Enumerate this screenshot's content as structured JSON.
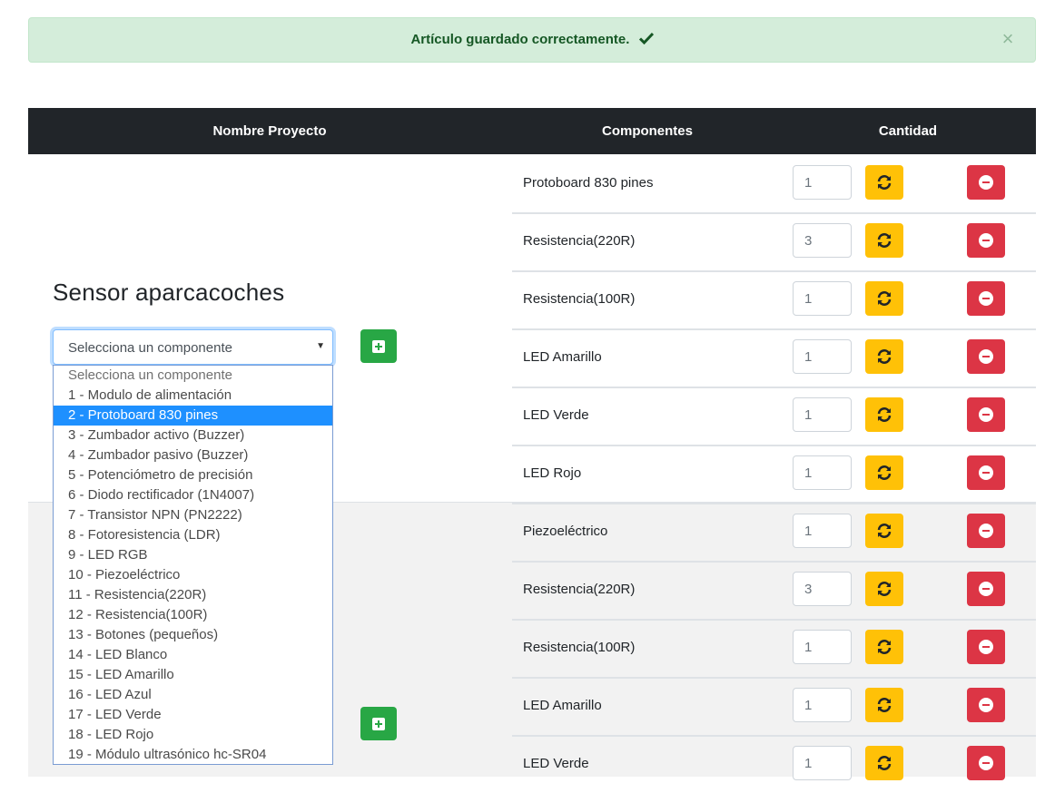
{
  "alert": {
    "message": "Artículo guardado correctamente.",
    "close_symbol": "×"
  },
  "table": {
    "headers": {
      "name": "Nombre Proyecto",
      "components": "Componentes",
      "quantity": "Cantidad"
    }
  },
  "project": {
    "name": "Sensor aparcacoches",
    "select": {
      "value": "Selecciona un componente",
      "arrow": "▼",
      "options": [
        "Selecciona un componente",
        "1 - Modulo de alimentación",
        "2 - Protoboard 830 pines",
        "3 - Zumbador activo (Buzzer)",
        "4 - Zumbador pasivo (Buzzer)",
        "5 - Potenciómetro de precisión",
        "6 - Diodo rectificador (1N4007)",
        "7 - Transistor NPN (PN2222)",
        "8 - Fotoresistencia (LDR)",
        "9 - LED RGB",
        "10 - Piezoeléctrico",
        "11 - Resistencia(220R)",
        "12 - Resistencia(100R)",
        "13 - Botones (pequeños)",
        "14 - LED Blanco",
        "15 - LED Amarillo",
        "16 - LED Azul",
        "17 - LED Verde",
        "18 - LED Rojo",
        "19 - Módulo ultrasónico hc-SR04"
      ],
      "highlighted": "2 - Protoboard 830 pines"
    }
  },
  "rows": [
    {
      "component": "Protoboard 830 pines",
      "qty": "1"
    },
    {
      "component": "Resistencia(220R)",
      "qty": "3"
    },
    {
      "component": "Resistencia(100R)",
      "qty": "1"
    },
    {
      "component": "LED Amarillo",
      "qty": "1"
    },
    {
      "component": "LED Verde",
      "qty": "1"
    },
    {
      "component": "LED Rojo",
      "qty": "1"
    },
    {
      "component": "Piezoeléctrico",
      "qty": "1"
    },
    {
      "component": "Resistencia(220R)",
      "qty": "3"
    },
    {
      "component": "Resistencia(100R)",
      "qty": "1"
    },
    {
      "component": "LED Amarillo",
      "qty": "1"
    },
    {
      "component": "LED Verde",
      "qty": "1"
    }
  ],
  "colors": {
    "alert_bg": "#d4edda",
    "header_bg": "#212529",
    "add_button": "#28a745",
    "update_button": "#ffc107",
    "delete_button": "#dc3545",
    "dropdown_highlight": "#1e90ff"
  },
  "icons": {
    "alert": "check-icon",
    "close": "close-icon",
    "add": "plus-square-icon",
    "update": "sync-icon",
    "delete": "minus-circle-icon"
  }
}
